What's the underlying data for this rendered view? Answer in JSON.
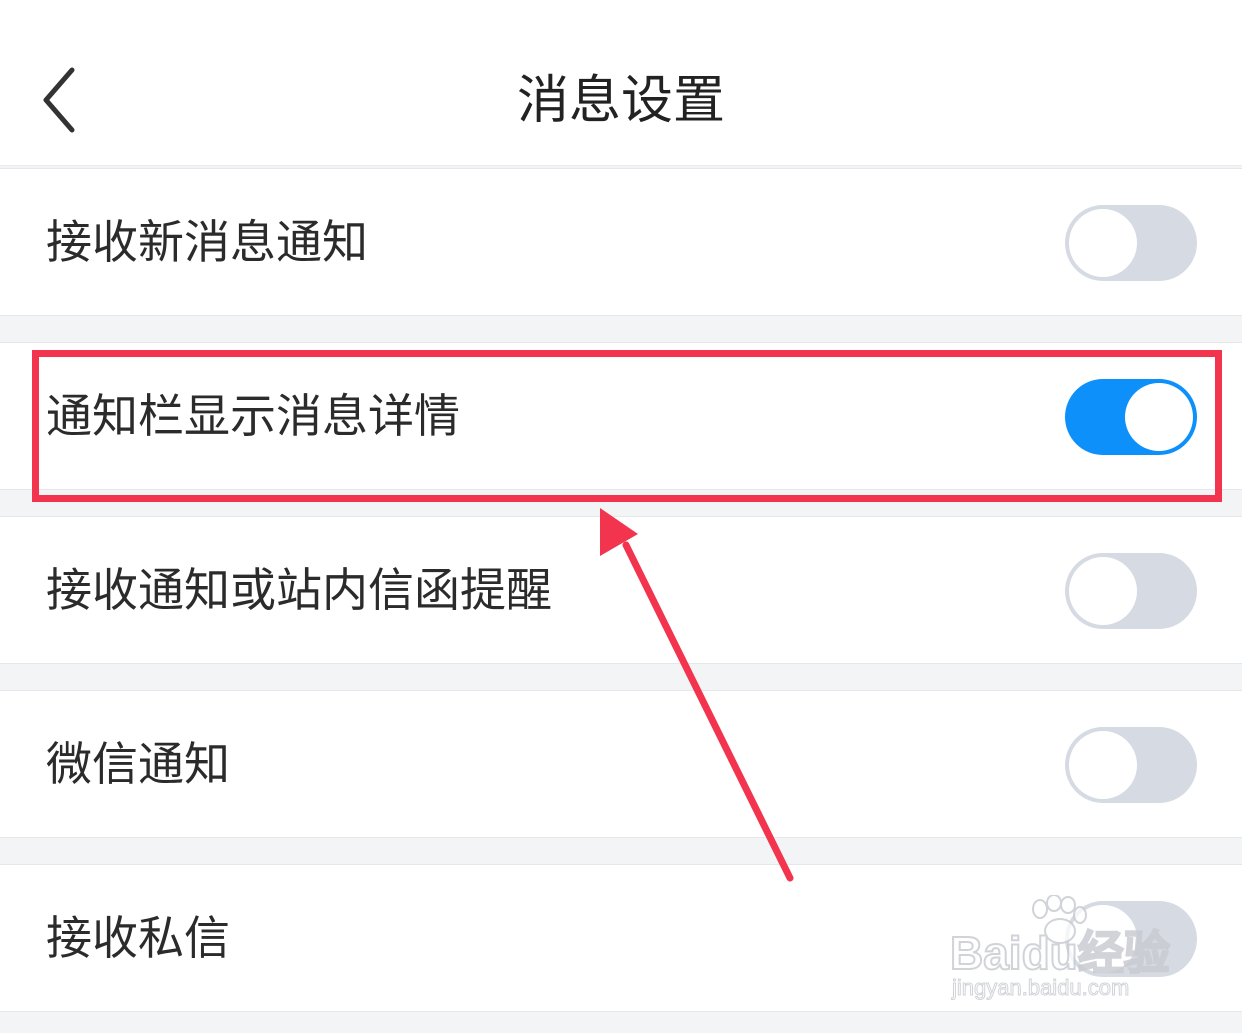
{
  "header": {
    "title": "消息设置",
    "back_icon": "chevron-left-icon"
  },
  "settings": [
    {
      "label": "接收新消息通知",
      "enabled": false
    },
    {
      "label": "通知栏显示消息详情",
      "enabled": true
    },
    {
      "label": "接收通知或站内信函提醒",
      "enabled": false
    },
    {
      "label": "微信通知",
      "enabled": false
    },
    {
      "label": "接收私信",
      "enabled": false
    }
  ],
  "colors": {
    "toggle_on": "#0e90fb",
    "toggle_off": "#d5dae3",
    "annotation": "#f2344e"
  },
  "annotation": {
    "highlighted_item": "通知栏显示消息详情"
  },
  "watermark": {
    "brand": "Baidu经验",
    "url": "jingyan.baidu.com"
  }
}
